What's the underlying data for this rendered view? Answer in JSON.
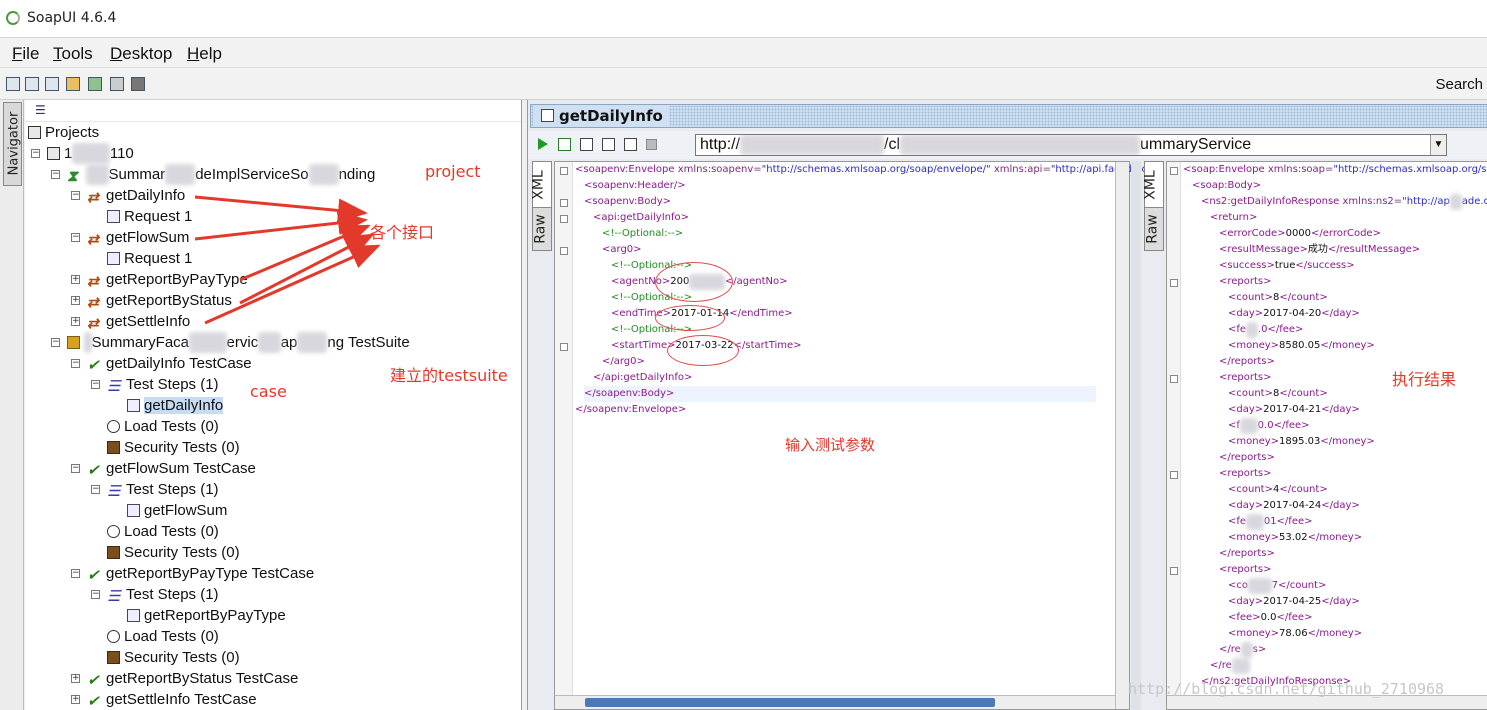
{
  "window": {
    "title": "SoapUI 4.6.4"
  },
  "menu": [
    {
      "key": "F",
      "rest": "ile"
    },
    {
      "key": "T",
      "rest": "ools"
    },
    {
      "key": "D",
      "rest": "esktop"
    },
    {
      "key": "H",
      "rest": "elp"
    }
  ],
  "toolbar": {
    "search_label": "Search"
  },
  "navigator": {
    "tab_label": "Navigator"
  },
  "tree": {
    "projects": "Projects",
    "project_prefix": "1",
    "project_suffix": "110",
    "interface_prefix": "Summar",
    "interface_mid": "deImplServiceSo",
    "interface_suffix": "nding",
    "op1": "getDailyInfo",
    "op1_req": "Request 1",
    "op2": "getFlowSum",
    "op2_req": "Request 1",
    "op3": "getReportByPayType",
    "op4": "getReportByStatus",
    "op5": "getSettleInfo",
    "suite_prefix": "SummaryFaca",
    "suite_mid": "ervic",
    "suite_mid2": "ap",
    "suite_suffix": "ng TestSuite",
    "tc1": "getDailyInfo TestCase",
    "tc1_steps": "Test Steps (1)",
    "tc1_step": "getDailyInfo",
    "tc1_load": "Load Tests (0)",
    "tc1_sec": "Security Tests (0)",
    "tc2": "getFlowSum TestCase",
    "tc2_steps": "Test Steps (1)",
    "tc2_step": "getFlowSum",
    "tc2_load": "Load Tests (0)",
    "tc2_sec": "Security Tests (0)",
    "tc3": "getReportByPayType TestCase",
    "tc3_steps": "Test Steps (1)",
    "tc3_step": "getReportByPayType",
    "tc3_load": "Load Tests (0)",
    "tc3_sec": "Security Tests (0)",
    "tc4": "getReportByStatus TestCase",
    "tc5": "getSettleInfo TestCase"
  },
  "annotations": {
    "project": "project",
    "interfaces": "各个接口",
    "testsuite": "建立的testsuite",
    "case": "case",
    "input": "输入测试参数",
    "result": "执行结果",
    "accent_color": "#e3392b"
  },
  "editor": {
    "title": "getDailyInfo",
    "url_start": "http://",
    "url_mid": "/cl",
    "url_end": "ummaryService",
    "request_tabs": [
      "XML",
      "Raw"
    ],
    "response_tabs": [
      "XML",
      "Raw"
    ]
  },
  "request_xml": {
    "l1_tag": "<soapenv:Envelope ",
    "l1_a1": "xmlns:soapenv=",
    "l1_v1": "\"http://schemas.xmlsoap.org/soap/envelope/\"",
    "l1_a2": " xmlns:api=",
    "l1_v2": "\"http://api.facade.c",
    "l2": "<soapenv:Header/>",
    "l3": "<soapenv:Body>",
    "l4": "<api:getDailyInfo>",
    "l5": "<!--Optional:-->",
    "l6": "<arg0>",
    "l7": "<!--Optional:-->",
    "l8_open": "<agentNo>",
    "l8_val": "200",
    "l8_close": "</agentNo>",
    "l9": "<!--Optional:-->",
    "l10_open": "<endTime>",
    "l10_val": "2017-01-14",
    "l10_close": "</endTime>",
    "l11": "<!--Optional:-->",
    "l12_open": "<startTime>",
    "l12_val": "2017-03-22",
    "l12_close": "</startTime>",
    "l13": "</arg0>",
    "l14": "</api:getDailyInfo>",
    "l15": "</soapenv:Body>",
    "l16": "</soapenv:Envelope>"
  },
  "response_xml": {
    "l1_tag": "<soap:Envelope ",
    "l1_a1": "xmlns:soap=",
    "l1_v1": "\"http://schemas.xmlsoap.org/soap",
    "l2": "<soap:Body>",
    "l3_tag": "<ns2:getDailyInfoResponse ",
    "l3_a": "xmlns:ns2=",
    "l3_v1": "\"http://ap",
    "l3_v2": "ade.cl",
    "l4": "<return>",
    "l5_open": "<errorCode>",
    "l5_val": "0000",
    "l5_close": "</errorCode>",
    "l6_open": "<resultMessage>",
    "l6_val": "成功",
    "l6_close": "</resultMessage>",
    "l7_open": "<success>",
    "l7_val": "true",
    "l7_close": "</success>",
    "r1_open": "<reports>",
    "r1_count": "8",
    "r1_day": "2017-04-20",
    "r1_fee_a": "<fe",
    "r1_fee_b": ".0</fee>",
    "r1_money": "8580.05",
    "r2_count": "8",
    "r2_day": "2017-04-21",
    "r2_fee_a": "<f",
    "r2_fee_b": "0.0</fee>",
    "r2_money": "1895.03",
    "r3_count": "4",
    "r3_day": "2017-04-24",
    "r3_fee_a": "<fe",
    "r3_fee_b": "01</fee>",
    "r3_money": "53.02",
    "r4_count_a": "<co",
    "r4_count_b": "7</count>",
    "r4_day": "2017-04-25",
    "r4_fee": "0.0",
    "r4_money": "78.06",
    "close_reports": "</reports>",
    "close_reports_partial": "</re",
    "close_reports_tail": "s>",
    "close_return": "</re",
    "close_resp": "</ns2:getDailyInfoResponse>"
  },
  "watermark": "http://blog.csdn.net/github_2710968"
}
